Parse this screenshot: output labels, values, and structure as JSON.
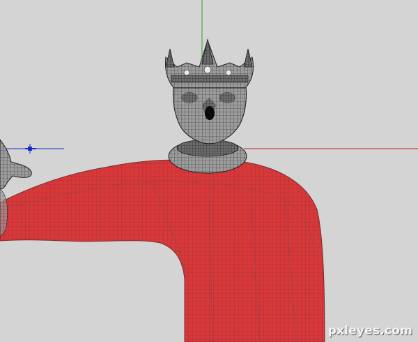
{
  "viewport": {
    "background": "#d4d4d4",
    "axes": {
      "x_color": "#cc2222",
      "y_color": "#2ea02e",
      "z_color": "#1a2cc8"
    }
  },
  "model": {
    "body_color": "#d9383a",
    "wire_color": "#8a3034",
    "head_color": "#9a9a9a",
    "head_wire_color": "#2a2a2a"
  },
  "watermark": {
    "text": "pxleyes.com"
  }
}
